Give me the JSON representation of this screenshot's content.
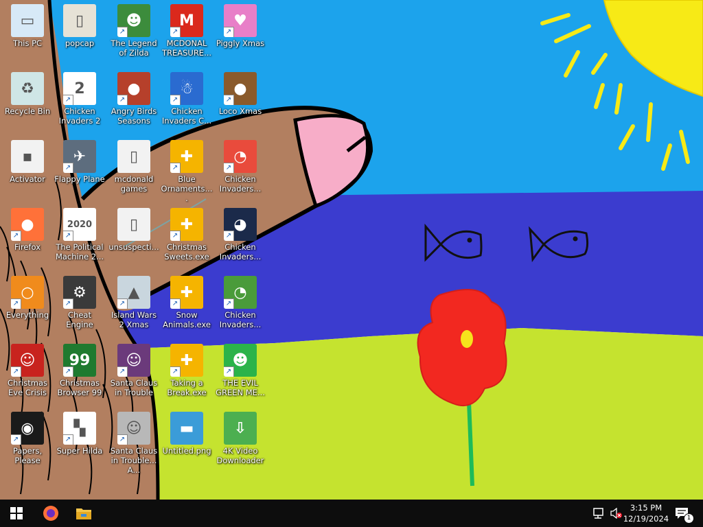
{
  "desktop": {
    "icons": [
      {
        "label": "This PC",
        "icon": "computer-icon",
        "color": "#d7e9f7",
        "glyph": "▭",
        "shortcut": false
      },
      {
        "label": "Recycle Bin",
        "icon": "recycle-bin-icon",
        "color": "#cfe6e6",
        "glyph": "♻",
        "shortcut": false
      },
      {
        "label": "Activator",
        "icon": "file-icon",
        "color": "#f2f2f2",
        "glyph": "▪",
        "shortcut": false
      },
      {
        "label": "Firefox",
        "icon": "firefox-icon",
        "color": "#ff7139",
        "glyph": "●",
        "shortcut": true
      },
      {
        "label": "Everything",
        "icon": "search-magnifier-icon",
        "color": "#f08b1c",
        "glyph": "○",
        "shortcut": true
      },
      {
        "label": "Christmas Eve Crisis",
        "icon": "santa-game-icon",
        "color": "#c8231e",
        "glyph": "☺",
        "shortcut": true
      },
      {
        "label": "Papers, Please",
        "icon": "papers-please-icon",
        "color": "#1a1a1a",
        "glyph": "◉",
        "shortcut": true
      },
      {
        "label": "popcap",
        "icon": "folder-icon",
        "color": "#e6e2d6",
        "glyph": "▯",
        "shortcut": false
      },
      {
        "label": "Chicken Invaders 2",
        "icon": "chicken-game-icon",
        "color": "#ffffff",
        "glyph": "2",
        "shortcut": true
      },
      {
        "label": "Flappy Plane",
        "icon": "plane-game-icon",
        "color": "#5d6d7e",
        "glyph": "✈",
        "shortcut": true
      },
      {
        "label": "The Political Machine 2...",
        "icon": "political-game-icon",
        "color": "#ffffff",
        "glyph": "2020",
        "shortcut": true
      },
      {
        "label": "Cheat Engine",
        "icon": "cheat-engine-icon",
        "color": "#3a3a3a",
        "glyph": "⚙",
        "shortcut": true
      },
      {
        "label": "Christmas Browser 99",
        "icon": "christmas-tree-icon",
        "color": "#1f7a2f",
        "glyph": "99",
        "shortcut": true
      },
      {
        "label": "Super Hilda",
        "icon": "pixel-dog-icon",
        "color": "#ffffff",
        "glyph": "▚",
        "shortcut": true
      },
      {
        "label": "The Legend of Zilda",
        "icon": "zelda-game-icon",
        "color": "#3c8c3c",
        "glyph": "☻",
        "shortcut": true
      },
      {
        "label": "Angry Birds Seasons",
        "icon": "angry-birds-icon",
        "color": "#b6402b",
        "glyph": "●",
        "shortcut": true
      },
      {
        "label": "mcdonald games",
        "icon": "folder-icon",
        "color": "#f2f2f2",
        "glyph": "▯",
        "shortcut": false
      },
      {
        "label": "unsuspecti...",
        "icon": "folder-icon",
        "color": "#f2f2f2",
        "glyph": "▯",
        "shortcut": false
      },
      {
        "label": "Island Wars 2 Xmas",
        "icon": "island-wars-icon",
        "color": "#c9d6de",
        "glyph": "▲",
        "shortcut": true
      },
      {
        "label": "Santa Claus in Trouble",
        "icon": "santa-claus-icon",
        "color": "#6b3a7b",
        "glyph": "☺",
        "shortcut": true
      },
      {
        "label": "Santa Claus in Trouble... A...",
        "icon": "santa-claus-icon",
        "color": "#b8b8b8",
        "glyph": "☺",
        "shortcut": true
      },
      {
        "label": "MCDONAL TREASURE...",
        "icon": "mcdonalds-icon",
        "color": "#da291c",
        "glyph": "M",
        "shortcut": true
      },
      {
        "label": "Chicken Invaders C...",
        "icon": "snowman-icon",
        "color": "#2a6bd0",
        "glyph": "☃",
        "shortcut": true
      },
      {
        "label": "Blue Ornaments....",
        "icon": "puzzle-exe-icon",
        "color": "#f5b400",
        "glyph": "✚",
        "shortcut": true
      },
      {
        "label": "Christmas Sweets.exe",
        "icon": "puzzle-exe-icon",
        "color": "#f5b400",
        "glyph": "✚",
        "shortcut": true
      },
      {
        "label": "Snow Animals.exe",
        "icon": "puzzle-exe-icon",
        "color": "#f5b400",
        "glyph": "✚",
        "shortcut": true
      },
      {
        "label": "Taking a Break.exe",
        "icon": "puzzle-exe-icon",
        "color": "#f5b400",
        "glyph": "✚",
        "shortcut": true
      },
      {
        "label": "Untitled.png",
        "icon": "image-file-icon",
        "color": "#3b9cd8",
        "glyph": "▬",
        "shortcut": false
      },
      {
        "label": "Piggly Xmas",
        "icon": "pig-game-icon",
        "color": "#e87fc8",
        "glyph": "♥",
        "shortcut": true
      },
      {
        "label": "Loco Xmas",
        "icon": "teddy-bear-icon",
        "color": "#8a5a2b",
        "glyph": "●",
        "shortcut": true
      },
      {
        "label": "Chicken Invaders...",
        "icon": "chicken-game-icon",
        "color": "#e94b3c",
        "glyph": "◔",
        "shortcut": true
      },
      {
        "label": "Chicken Invaders...",
        "icon": "chicken-game-icon",
        "color": "#1b2a4a",
        "glyph": "◕",
        "shortcut": true
      },
      {
        "label": "Chicken Invaders...",
        "icon": "chicken-game-icon",
        "color": "#4a9b3a",
        "glyph": "◔",
        "shortcut": true
      },
      {
        "label": "THE EVIL GREEN ME...",
        "icon": "messenger-icon",
        "color": "#2bb34a",
        "glyph": "☻",
        "shortcut": true
      },
      {
        "label": "4K Video Downloader",
        "icon": "video-downloader-icon",
        "color": "#4caf50",
        "glyph": "⇩",
        "shortcut": false
      }
    ]
  },
  "taskbar": {
    "start_icon": "windows-start-icon",
    "pinned": [
      {
        "name": "firefox",
        "icon": "firefox-icon"
      },
      {
        "name": "file-explorer",
        "icon": "folder-icon"
      }
    ],
    "time": "3:15 PM",
    "date": "12/19/2024",
    "notification_count": "1"
  }
}
